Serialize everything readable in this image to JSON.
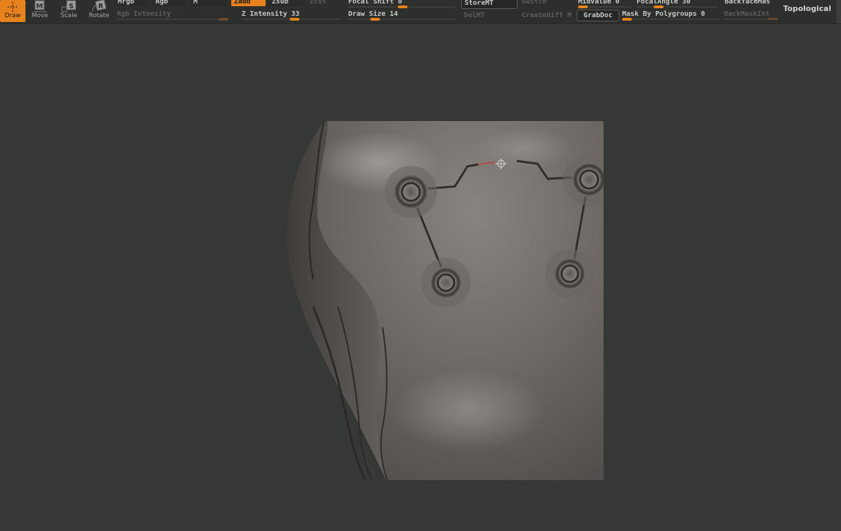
{
  "toolbar": {
    "tools": [
      {
        "label": "Draw",
        "icon": "draw-crosshair-icon",
        "active": true
      },
      {
        "label": "Move",
        "icon": "move-icon",
        "active": false
      },
      {
        "label": "Scale",
        "icon": "scale-icon",
        "active": false
      },
      {
        "label": "Rotate",
        "icon": "rotate-icon",
        "active": false
      }
    ],
    "mrgb": "Mrgb",
    "rgb": "Rgb",
    "m": "M",
    "rgb_intensity": "Rgb Intensity",
    "zadd": "Zadd",
    "zsub": "Zsub",
    "zcut": "Zcut",
    "z_intensity": "Z Intensity 33",
    "focal_shift": "Focal Shift 0",
    "draw_size": "Draw Size 14",
    "store_mt": "StoreMT",
    "del_mt": "DelMT",
    "switch": "Switch",
    "create_diff": "CreateDiff M",
    "midvalue": "Midvalue 0",
    "grabdoc": "GrabDoc",
    "focal_angle": "FocalAngle 30",
    "mask_by_polygroups": "Mask By Polygroups 0",
    "backface_mask": "BackfaceMas",
    "back_mask_int": "BackMaskInt",
    "topological": "Topological"
  },
  "colors": {
    "accent": "#e8821c",
    "background": "#353835",
    "toolbar": "#2d2f2d"
  }
}
